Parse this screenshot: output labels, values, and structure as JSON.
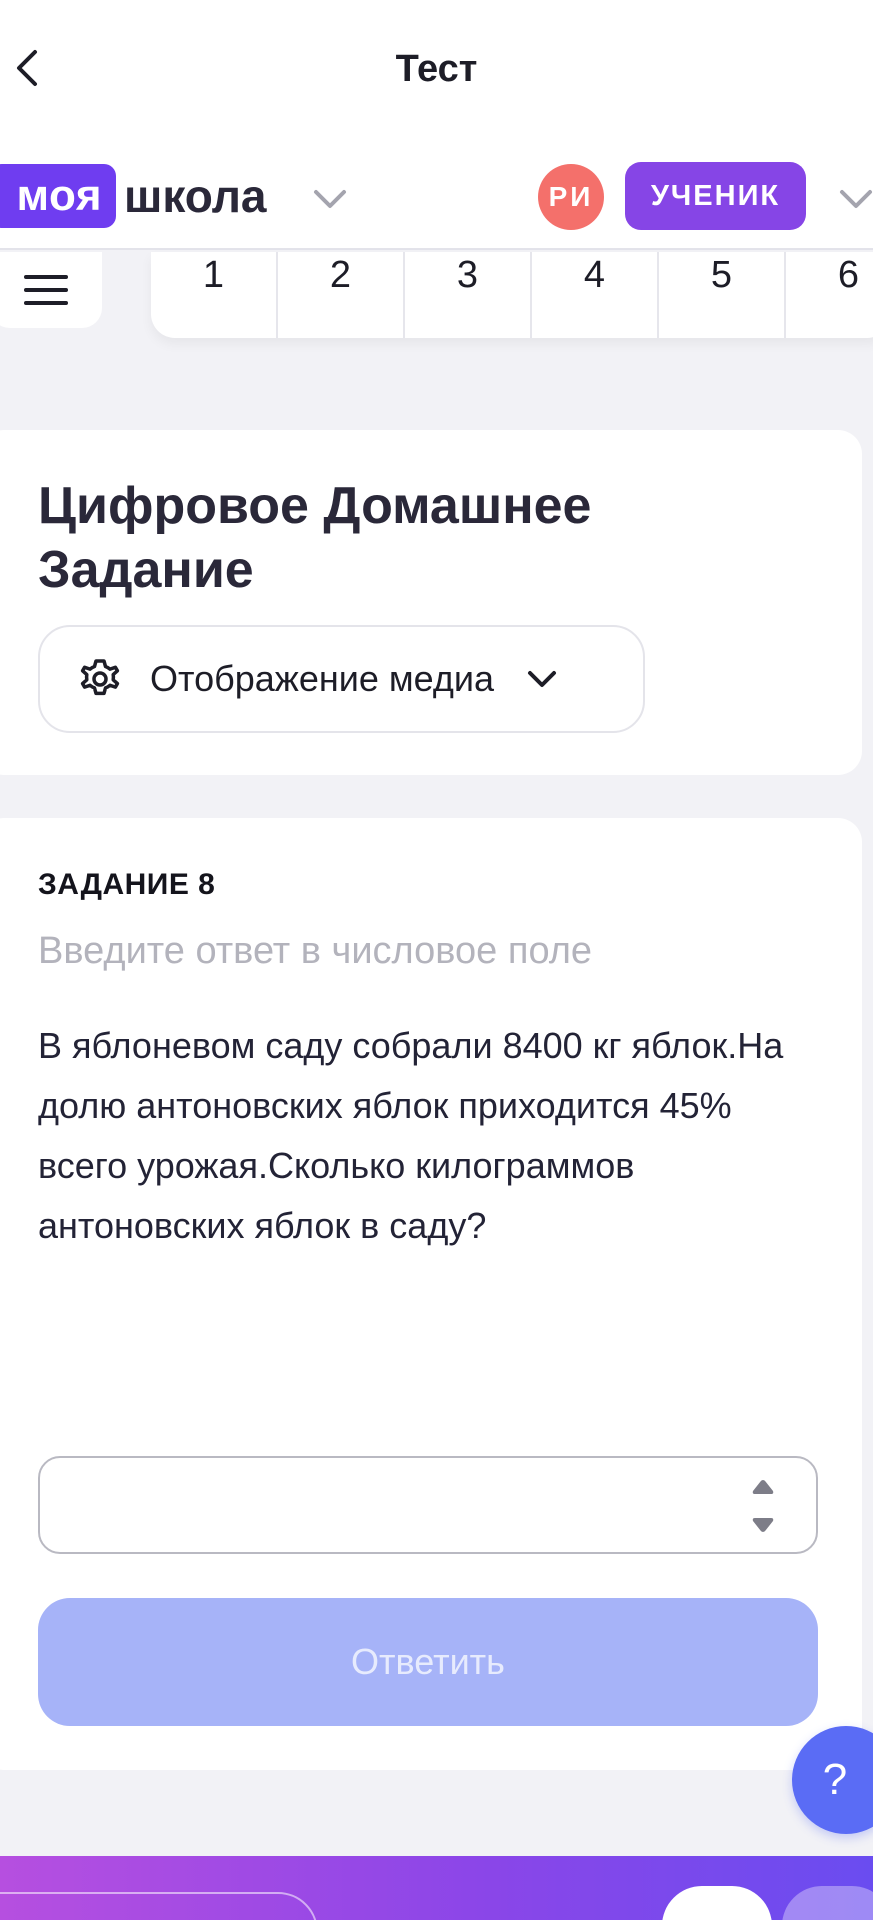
{
  "header": {
    "title": "Тест"
  },
  "school": {
    "logo_part1": "моя",
    "logo_part2": "школа",
    "avatar_initials": "РИ",
    "role": "УЧЕНИК"
  },
  "question_nav": {
    "numbers": [
      "1",
      "2",
      "3",
      "4",
      "5",
      "6"
    ]
  },
  "homework": {
    "title": "Цифровое Домашнее Задание",
    "media_toggle_label": "Отображение медиа"
  },
  "task": {
    "label": "ЗАДАНИЕ 8",
    "hint": "Введите ответ в числовое поле",
    "text": "В яблоневом саду собрали 8400 кг яблок.На долю антоновских яблок приходится 45% всего урожая.Сколько килограммов антоновских яблок в саду?",
    "answer_value": "",
    "submit_label": "Ответить"
  },
  "help": {
    "label": "?"
  },
  "colors": {
    "brand_purple": "#6f3df0",
    "role_purple": "#8645e6",
    "avatar_red": "#f4706b",
    "submit_disabled": "#a6b3f8",
    "help_blue": "#5a6cf5"
  }
}
